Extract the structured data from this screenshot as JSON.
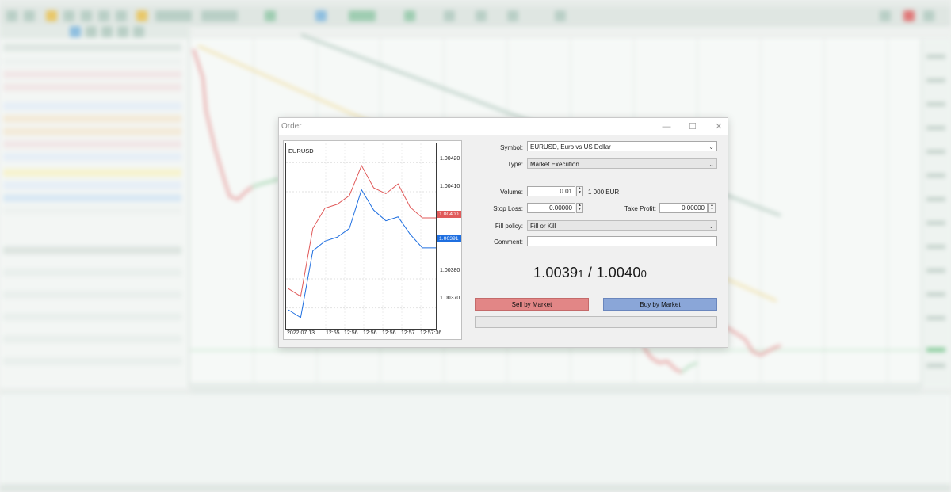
{
  "dialog": {
    "title": "Order",
    "symbol_label": "Symbol:",
    "symbol_value": "EURUSD, Euro vs US Dollar",
    "type_label": "Type:",
    "type_value": "Market Execution",
    "volume_label": "Volume:",
    "volume_value": "0.01",
    "volume_note": "1 000 EUR",
    "stop_loss_label": "Stop Loss:",
    "stop_loss_value": "0.00000",
    "take_profit_label": "Take Profit:",
    "take_profit_value": "0.00000",
    "fill_policy_label": "Fill policy:",
    "fill_policy_value": "Fill or Kill",
    "comment_label": "Comment:",
    "comment_value": "",
    "bid_main": "1.0039",
    "bid_small": "1",
    "separator": " / ",
    "ask_main": "1.0040",
    "ask_small": "0",
    "sell_label": "Sell by Market",
    "buy_label": "Buy by Market",
    "chevron": "⌄",
    "minimize": "—",
    "maximize": "☐",
    "close": "✕"
  },
  "mini_chart": {
    "symbol": "EURUSD",
    "price_labels": [
      "1.00420",
      "1.00410",
      "1.00380",
      "1.00370"
    ],
    "ask_badge": "1.00400",
    "bid_badge": "1.00391",
    "time_labels": [
      "2022.07.13",
      "12:55",
      "12:56",
      "12:56",
      "12:56",
      "12:57",
      "12:57:36"
    ],
    "colors": {
      "ask": "#e05a5a",
      "bid": "#1f6fe0"
    }
  },
  "chart_data": {
    "type": "line",
    "title": "EURUSD",
    "x": [
      "2022.07.13",
      "12:55",
      "12:56",
      "12:56",
      "12:56",
      "12:57",
      "12:57:36"
    ],
    "series": [
      {
        "name": "",
        "color": "#e05a5a",
        "values": [
          1.00376,
          1.00374,
          1.00398,
          1.00404,
          1.00406,
          1.00408,
          1.00419,
          1.00412,
          1.00409,
          1.00413,
          1.00404,
          1.00401
        ]
      },
      {
        "name": "",
        "color": "#1f6fe0",
        "values": [
          1.00369,
          1.00367,
          1.00389,
          1.00393,
          1.00395,
          1.00397,
          1.00411,
          1.00403,
          1.004,
          1.00402,
          1.00395,
          1.00391
        ]
      }
    ],
    "ylim": [
      1.00365,
      1.00425
    ],
    "yticks": [
      1.0042,
      1.0041,
      1.0038,
      1.0037
    ],
    "grid": true
  }
}
